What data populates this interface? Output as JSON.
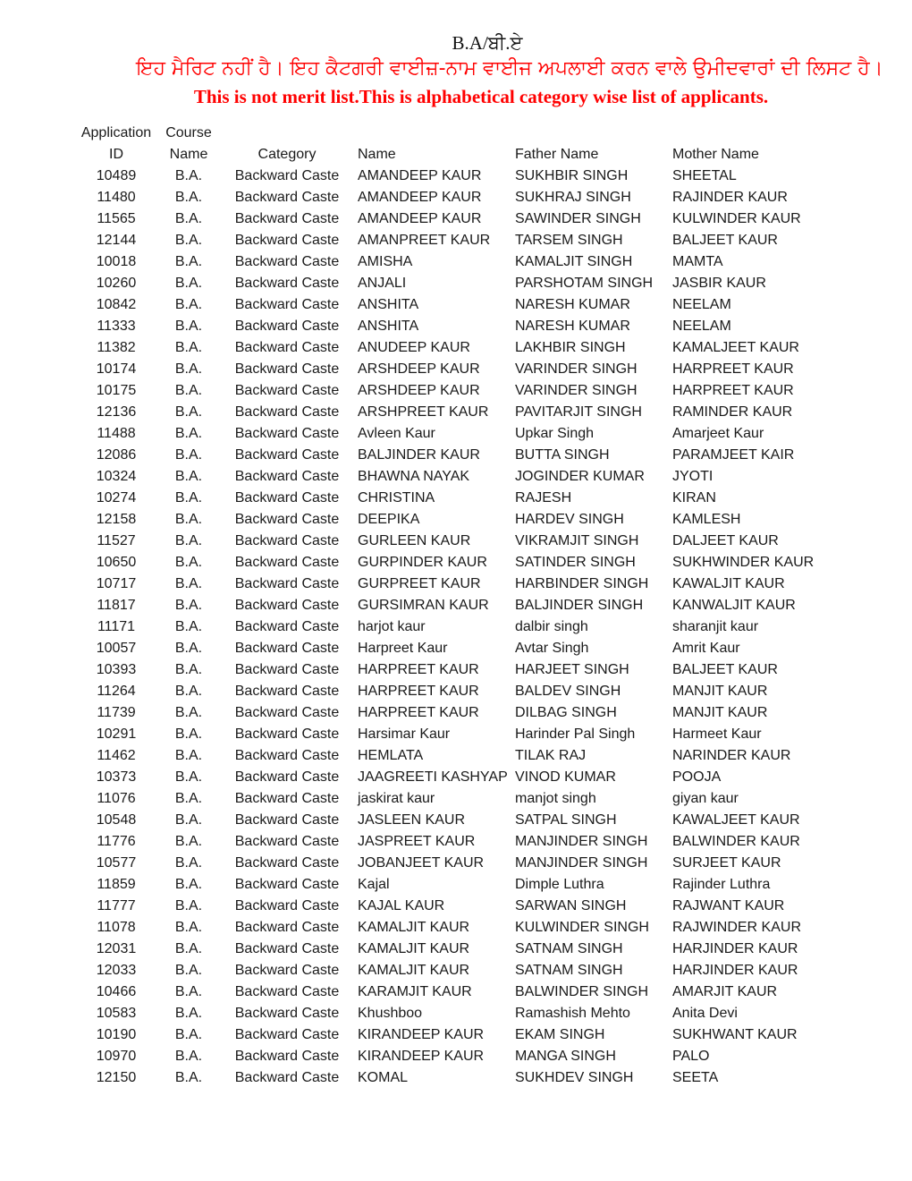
{
  "header": {
    "course_title": "B.A/ਬੀ.ਏ",
    "notice_punjabi": "ਇਹ ਮੈਰਿਟ ਨਹੀਂ ਹੈ। ਇਹ ਕੈਟਗਰੀ ਵਾਈਜ਼-ਨਾਮ ਵਾਈਜ ਅਪਲਾਈ ਕਰਨ ਵਾਲੇ ਉਮੀਦਵਾਰਾਂ ਦੀ ਲਿਸਟ ਹੈ।",
    "notice_english": "This is not merit list.This is alphabetical category wise list of applicants.",
    "notice_color": "#ff0000"
  },
  "table": {
    "columns": {
      "application_id_line1": "Application",
      "application_id_line2": "ID",
      "course_name_line1": "Course",
      "course_name_line2": "Name",
      "category": "Category",
      "name": "Name",
      "father_name": "Father Name",
      "mother_name": "Mother Name"
    },
    "rows": [
      {
        "id": "10489",
        "course": "B.A.",
        "category": "Backward Caste",
        "name": "AMANDEEP KAUR",
        "father": "SUKHBIR SINGH",
        "mother": "SHEETAL"
      },
      {
        "id": "11480",
        "course": "B.A.",
        "category": "Backward Caste",
        "name": "AMANDEEP KAUR",
        "father": "SUKHRAJ SINGH",
        "mother": "RAJINDER KAUR"
      },
      {
        "id": "11565",
        "course": "B.A.",
        "category": "Backward Caste",
        "name": "AMANDEEP KAUR",
        "father": "SAWINDER SINGH",
        "mother": "KULWINDER KAUR"
      },
      {
        "id": "12144",
        "course": "B.A.",
        "category": "Backward Caste",
        "name": "AMANPREET KAUR",
        "father": "TARSEM SINGH",
        "mother": "BALJEET KAUR"
      },
      {
        "id": "10018",
        "course": "B.A.",
        "category": "Backward Caste",
        "name": "AMISHA",
        "father": "KAMALJIT SINGH",
        "mother": "MAMTA"
      },
      {
        "id": "10260",
        "course": "B.A.",
        "category": "Backward Caste",
        "name": "ANJALI",
        "father": "PARSHOTAM SINGH",
        "mother": "JASBIR KAUR"
      },
      {
        "id": "10842",
        "course": "B.A.",
        "category": "Backward Caste",
        "name": "ANSHITA",
        "father": "NARESH KUMAR",
        "mother": "NEELAM"
      },
      {
        "id": "11333",
        "course": "B.A.",
        "category": "Backward Caste",
        "name": "ANSHITA",
        "father": "NARESH KUMAR",
        "mother": "NEELAM"
      },
      {
        "id": "11382",
        "course": "B.A.",
        "category": "Backward Caste",
        "name": "ANUDEEP KAUR",
        "father": "LAKHBIR SINGH",
        "mother": "KAMALJEET KAUR"
      },
      {
        "id": "10174",
        "course": "B.A.",
        "category": "Backward Caste",
        "name": "ARSHDEEP KAUR",
        "father": "VARINDER SINGH",
        "mother": "HARPREET KAUR"
      },
      {
        "id": "10175",
        "course": "B.A.",
        "category": "Backward Caste",
        "name": "ARSHDEEP KAUR",
        "father": "VARINDER SINGH",
        "mother": "HARPREET KAUR"
      },
      {
        "id": "12136",
        "course": "B.A.",
        "category": "Backward Caste",
        "name": "ARSHPREET KAUR",
        "father": "PAVITARJIT SINGH",
        "mother": "RAMINDER KAUR"
      },
      {
        "id": "11488",
        "course": "B.A.",
        "category": "Backward Caste",
        "name": "Avleen Kaur",
        "father": "Upkar Singh",
        "mother": "Amarjeet Kaur"
      },
      {
        "id": "12086",
        "course": "B.A.",
        "category": "Backward Caste",
        "name": "BALJINDER KAUR",
        "father": "BUTTA SINGH",
        "mother": "PARAMJEET KAIR"
      },
      {
        "id": "10324",
        "course": "B.A.",
        "category": "Backward Caste",
        "name": "BHAWNA NAYAK",
        "father": "JOGINDER  KUMAR",
        "mother": "JYOTI"
      },
      {
        "id": "10274",
        "course": "B.A.",
        "category": "Backward Caste",
        "name": "CHRISTINA",
        "father": "RAJESH",
        "mother": "KIRAN"
      },
      {
        "id": "12158",
        "course": "B.A.",
        "category": "Backward Caste",
        "name": "DEEPIKA",
        "father": "HARDEV SINGH",
        "mother": "KAMLESH"
      },
      {
        "id": "11527",
        "course": "B.A.",
        "category": "Backward Caste",
        "name": "GURLEEN KAUR",
        "father": "VIKRAMJIT SINGH",
        "mother": "DALJEET KAUR"
      },
      {
        "id": "10650",
        "course": "B.A.",
        "category": "Backward Caste",
        "name": "GURPINDER KAUR",
        "father": "SATINDER SINGH",
        "mother": "SUKHWINDER KAUR"
      },
      {
        "id": "10717",
        "course": "B.A.",
        "category": "Backward Caste",
        "name": "GURPREET KAUR",
        "father": "HARBINDER SINGH",
        "mother": "KAWALJIT KAUR"
      },
      {
        "id": "11817",
        "course": "B.A.",
        "category": "Backward Caste",
        "name": "GURSIMRAN KAUR",
        "father": "BALJINDER SINGH",
        "mother": "KANWALJIT KAUR"
      },
      {
        "id": "11171",
        "course": "B.A.",
        "category": "Backward Caste",
        "name": "harjot kaur",
        "father": "dalbir singh",
        "mother": "sharanjit kaur"
      },
      {
        "id": "10057",
        "course": "B.A.",
        "category": "Backward Caste",
        "name": "Harpreet Kaur",
        "father": "Avtar Singh",
        "mother": "Amrit Kaur"
      },
      {
        "id": "10393",
        "course": "B.A.",
        "category": "Backward Caste",
        "name": "HARPREET KAUR",
        "father": "HARJEET SINGH",
        "mother": "BALJEET KAUR"
      },
      {
        "id": "11264",
        "course": "B.A.",
        "category": "Backward Caste",
        "name": "HARPREET KAUR",
        "father": "BALDEV SINGH",
        "mother": "MANJIT KAUR"
      },
      {
        "id": "11739",
        "course": "B.A.",
        "category": "Backward Caste",
        "name": "HARPREET KAUR",
        "father": "DILBAG SINGH",
        "mother": "MANJIT KAUR"
      },
      {
        "id": "10291",
        "course": "B.A.",
        "category": "Backward Caste",
        "name": "Harsimar Kaur",
        "father": "Harinder Pal Singh",
        "mother": "Harmeet Kaur"
      },
      {
        "id": "11462",
        "course": "B.A.",
        "category": "Backward Caste",
        "name": "HEMLATA",
        "father": "TILAK RAJ",
        "mother": "NARINDER KAUR"
      },
      {
        "id": "10373",
        "course": "B.A.",
        "category": "Backward Caste",
        "name": "JAAGREETI KASHYAP",
        "father": "VINOD KUMAR",
        "mother": "POOJA"
      },
      {
        "id": "11076",
        "course": "B.A.",
        "category": "Backward Caste",
        "name": "jaskirat kaur",
        "father": "manjot singh",
        "mother": "giyan kaur"
      },
      {
        "id": "10548",
        "course": "B.A.",
        "category": "Backward Caste",
        "name": "JASLEEN KAUR",
        "father": "SATPAL SINGH",
        "mother": "KAWALJEET KAUR"
      },
      {
        "id": "11776",
        "course": "B.A.",
        "category": "Backward Caste",
        "name": "JASPREET KAUR",
        "father": "MANJINDER SINGH",
        "mother": "BALWINDER KAUR"
      },
      {
        "id": "10577",
        "course": "B.A.",
        "category": "Backward Caste",
        "name": "JOBANJEET KAUR",
        "father": "MANJINDER SINGH",
        "mother": "SURJEET KAUR"
      },
      {
        "id": "11859",
        "course": "B.A.",
        "category": "Backward Caste",
        "name": "Kajal",
        "father": "Dimple Luthra",
        "mother": "Rajinder Luthra"
      },
      {
        "id": "11777",
        "course": "B.A.",
        "category": "Backward Caste",
        "name": "KAJAL KAUR",
        "father": "SARWAN SINGH",
        "mother": "RAJWANT KAUR"
      },
      {
        "id": "11078",
        "course": "B.A.",
        "category": "Backward Caste",
        "name": "KAMALJIT KAUR",
        "father": "KULWINDER SINGH",
        "mother": "RAJWINDER KAUR"
      },
      {
        "id": "12031",
        "course": "B.A.",
        "category": "Backward Caste",
        "name": "KAMALJIT KAUR",
        "father": "SATNAM SINGH",
        "mother": "HARJINDER KAUR"
      },
      {
        "id": "12033",
        "course": "B.A.",
        "category": "Backward Caste",
        "name": "KAMALJIT KAUR",
        "father": "SATNAM SINGH",
        "mother": "HARJINDER KAUR"
      },
      {
        "id": "10466",
        "course": "B.A.",
        "category": "Backward Caste",
        "name": "KARAMJIT KAUR",
        "father": "BALWINDER SINGH",
        "mother": "AMARJIT KAUR"
      },
      {
        "id": "10583",
        "course": "B.A.",
        "category": "Backward Caste",
        "name": "Khushboo",
        "father": "Ramashish Mehto",
        "mother": "Anita Devi"
      },
      {
        "id": "10190",
        "course": "B.A.",
        "category": "Backward Caste",
        "name": "KIRANDEEP KAUR",
        "father": "EKAM SINGH",
        "mother": "SUKHWANT KAUR"
      },
      {
        "id": "10970",
        "course": "B.A.",
        "category": "Backward Caste",
        "name": "KIRANDEEP KAUR",
        "father": "MANGA SINGH",
        "mother": "PALO"
      },
      {
        "id": "12150",
        "course": "B.A.",
        "category": "Backward Caste",
        "name": "KOMAL",
        "father": "SUKHDEV SINGH",
        "mother": "SEETA"
      }
    ]
  }
}
